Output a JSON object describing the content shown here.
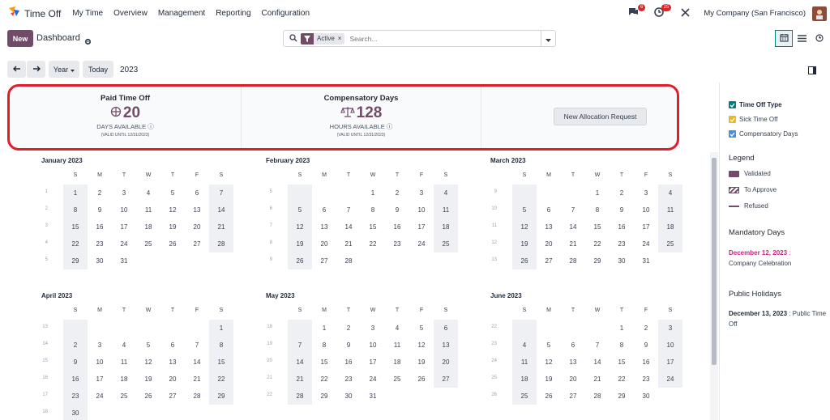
{
  "navbar": {
    "app_name": "Time Off",
    "menu": [
      "My Time",
      "Overview",
      "Management",
      "Reporting",
      "Configuration"
    ],
    "messages_count": "6",
    "activities_count": "25",
    "company": "My Company (San Francisco)"
  },
  "control": {
    "new_label": "New",
    "title": "Dashboard",
    "facet_label": "Active",
    "search_placeholder": "Search..."
  },
  "toolbar": {
    "scale_label": "Year",
    "today_label": "Today",
    "year": "2023"
  },
  "cards": [
    {
      "title": "Paid Time Off",
      "value": "20",
      "unit": "DAYS AVAILABLE",
      "valid": "(VALID UNTIL 12/31/2023)"
    },
    {
      "title": "Compensatory Days",
      "value": "128",
      "unit": "HOURS AVAILABLE",
      "valid": "(VALID UNTIL 12/31/2023)"
    }
  ],
  "allocation_button": "New Allocation Request",
  "weekdays": [
    "S",
    "M",
    "T",
    "W",
    "T",
    "F",
    "S"
  ],
  "months": [
    {
      "name": "January 2023",
      "offset": 0,
      "days": 31,
      "first_week": 1
    },
    {
      "name": "February 2023",
      "offset": 3,
      "days": 28,
      "first_week": 5
    },
    {
      "name": "March 2023",
      "offset": 3,
      "days": 31,
      "first_week": 9
    },
    {
      "name": "April 2023",
      "offset": 6,
      "days": 30,
      "first_week": 13
    },
    {
      "name": "May 2023",
      "offset": 1,
      "days": 31,
      "first_week": 18
    },
    {
      "name": "June 2023",
      "offset": 4,
      "days": 30,
      "first_week": 22
    }
  ],
  "sidebar": {
    "time_off_type_label": "Time Off Type",
    "types": [
      {
        "label": "Sick Time Off",
        "color": "#e8b923"
      },
      {
        "label": "Compensatory Days",
        "color": "#4a90d9"
      }
    ],
    "legend_title": "Legend",
    "legend": [
      {
        "label": "Validated",
        "style": "solid"
      },
      {
        "label": "To Approve",
        "style": "striped"
      },
      {
        "label": "Refused",
        "style": "line"
      }
    ],
    "mandatory_title": "Mandatory Days",
    "mandatory_date": "December 12, 2023",
    "mandatory_sep": " :",
    "mandatory_name": "Company Celebration",
    "holidays_title": "Public Holidays",
    "holiday_date": "December 13, 2023",
    "holiday_name": " : Public Time Off"
  },
  "colors": {
    "brand": "#714b67",
    "accent": "#017e84",
    "highlight_border": "#e11d29"
  }
}
